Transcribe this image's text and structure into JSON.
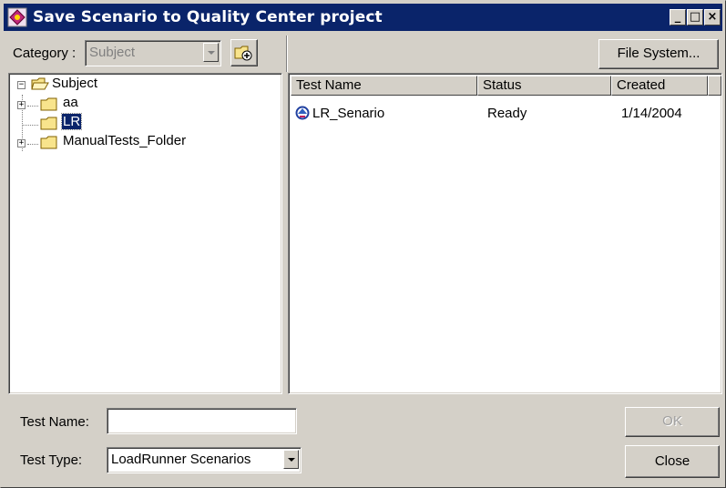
{
  "window": {
    "title": "Save Scenario to Quality Center project",
    "minimize_glyph": "_",
    "maximize_glyph": "□",
    "close_glyph": "×"
  },
  "category": {
    "label": "Category :",
    "value": "Subject"
  },
  "toolbar": {
    "file_system_label": "File System..."
  },
  "tree": {
    "root": "Subject",
    "items": [
      {
        "label": "aa",
        "expandable": true
      },
      {
        "label": "LR",
        "expandable": false,
        "selected": true
      },
      {
        "label": "ManualTests_Folder",
        "expandable": true
      }
    ]
  },
  "list": {
    "columns": [
      "Test Name",
      "Status",
      "Created"
    ],
    "rows": [
      {
        "name": "LR_Senario",
        "status": "Ready",
        "created": "1/14/2004"
      }
    ]
  },
  "form": {
    "test_name_label": "Test Name:",
    "test_name_value": "",
    "test_type_label": "Test Type:",
    "test_type_value": "LoadRunner Scenarios"
  },
  "buttons": {
    "ok_label": "OK",
    "close_label": "Close"
  },
  "colors": {
    "titlebar": "#0a246a",
    "dialog_face": "#d4d0c8",
    "folder_yellow": "#f8e48c"
  }
}
